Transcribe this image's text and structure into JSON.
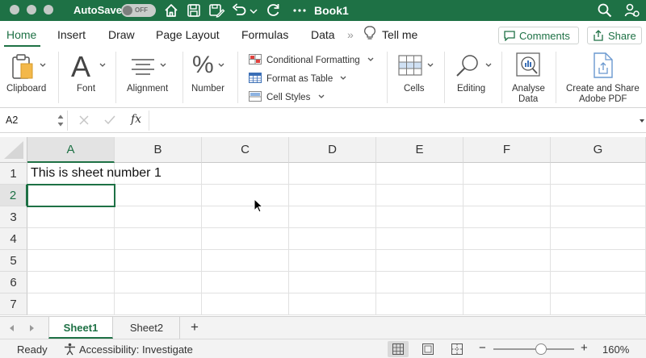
{
  "titlebar": {
    "autosave_label": "AutoSave",
    "autosave_state": "OFF",
    "document_title": "Book1"
  },
  "tabs": {
    "home": "Home",
    "insert": "Insert",
    "draw": "Draw",
    "page_layout": "Page Layout",
    "formulas": "Formulas",
    "data": "Data",
    "more": "»",
    "tell_me": "Tell me",
    "comments": "Comments",
    "share": "Share"
  },
  "ribbon": {
    "clipboard": "Clipboard",
    "font": "Font",
    "alignment": "Alignment",
    "number": "Number",
    "conditional_formatting": "Conditional Formatting",
    "format_as_table": "Format as Table",
    "cell_styles": "Cell Styles",
    "cells": "Cells",
    "editing": "Editing",
    "analyse_data_1": "Analyse",
    "analyse_data_2": "Data",
    "create_share_1": "Create and Share",
    "create_share_2": "Adobe PDF"
  },
  "formula_bar": {
    "name_box": "A2",
    "fx": "fx",
    "formula": ""
  },
  "grid": {
    "columns": [
      "A",
      "B",
      "C",
      "D",
      "E",
      "F",
      "G"
    ],
    "rows": [
      "1",
      "2",
      "3",
      "4",
      "5",
      "6",
      "7"
    ],
    "selected_column": "A",
    "selected_row": "2",
    "cell_A1": "This is sheet number 1"
  },
  "sheets": {
    "tabs": [
      "Sheet1",
      "Sheet2"
    ],
    "active": "Sheet1",
    "add": "+"
  },
  "statusbar": {
    "ready": "Ready",
    "accessibility": "Accessibility: Investigate",
    "zoom_minus": "−",
    "zoom_plus": "+",
    "zoom": "160%",
    "zoom_percent": 160
  },
  "colors": {
    "accent": "#1e7145",
    "title_bar": "#1e7145"
  }
}
